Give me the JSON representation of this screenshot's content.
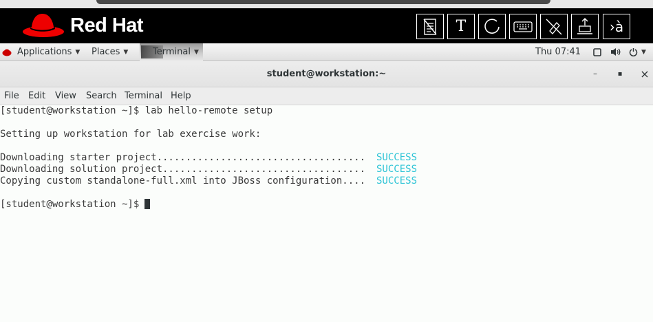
{
  "banner": {
    "brand": "Red Hat",
    "tools": [
      {
        "name": "notes-icon",
        "label": ""
      },
      {
        "name": "text-tool-icon",
        "label": "T"
      },
      {
        "name": "circle-tool-icon",
        "label": ""
      },
      {
        "name": "keyboard-icon",
        "label": ""
      },
      {
        "name": "mouse-off-icon",
        "label": ""
      },
      {
        "name": "eject-icon",
        "label": ""
      },
      {
        "name": "terminal-icon",
        "label": "›à"
      }
    ]
  },
  "topbar": {
    "applications": "Applications",
    "places": "Places",
    "task": "Terminal",
    "clock": "Thu 07:41"
  },
  "window": {
    "title": "student@workstation:~",
    "minimize": "–",
    "maximize": "▪",
    "close": "×"
  },
  "menu": [
    "File",
    "Edit",
    "View",
    "Search",
    "Terminal",
    "Help"
  ],
  "terminal": {
    "lines": [
      "[student@workstation ~]$ lab hello-remote setup",
      "",
      "Setting up workstation for lab exercise work:",
      "",
      "Downloading starter project....................................",
      "Downloading solution project...................................",
      "Copying custom standalone-full.xml into JBoss configuration....",
      "",
      "[student@workstation ~]$ "
    ],
    "status": [
      "SUCCESS",
      "SUCCESS",
      "SUCCESS"
    ]
  },
  "colors": {
    "success": "#2ec4d6",
    "hat": "#ee0000"
  }
}
